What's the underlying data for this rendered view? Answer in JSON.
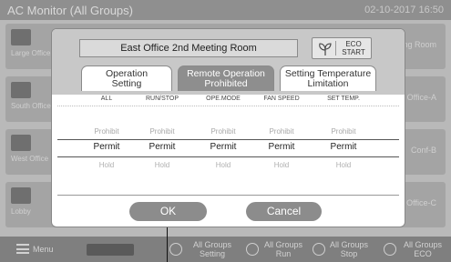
{
  "background": {
    "title": "AC Monitor (All Groups)",
    "date": "02-10-2017 16:50",
    "rows": [
      {
        "label": "Large Office",
        "right": "Meeting Room"
      },
      {
        "label": "South Office",
        "right": "Office-A"
      },
      {
        "label": "West Office",
        "right": "Conf-B"
      },
      {
        "label": "Lobby",
        "right": "Office-C"
      }
    ],
    "bottom_bar": {
      "menu": "Menu",
      "groups_setting": "All Groups Setting",
      "groups_run": "All Groups Run",
      "groups_stop": "All Groups Stop",
      "groups_eco": "All Groups ECO"
    }
  },
  "dialog": {
    "room_name": "East Office 2nd Meeting Room",
    "eco_button": {
      "line1": "ECO",
      "line2": "START",
      "icon": "leaf-icon"
    },
    "tabs": [
      {
        "line1": "Operation",
        "line2": "Setting",
        "active": false
      },
      {
        "line1": "Remote Operation",
        "line2": "Prohibited",
        "active": true
      },
      {
        "line1": "Setting Temperature",
        "line2": "Limitation",
        "active": false
      }
    ],
    "columns": [
      "ALL",
      "RUN/STOP",
      "OPE.MODE",
      "FAN SPEED",
      "SET TEMP."
    ],
    "rows": {
      "prohibit": [
        "Prohibit",
        "Prohibit",
        "Prohibit",
        "Prohibit",
        "Prohibit"
      ],
      "permit": [
        "Permit",
        "Permit",
        "Permit",
        "Permit",
        "Permit"
      ],
      "hold": [
        "Hold",
        "Hold",
        "Hold",
        "Hold",
        "Hold"
      ]
    },
    "ok_label": "OK",
    "cancel_label": "Cancel"
  },
  "colors": {
    "dialog_header": "#c8c8c8",
    "active_tab": "#8e8e8e",
    "button": "#8c8c8c"
  }
}
